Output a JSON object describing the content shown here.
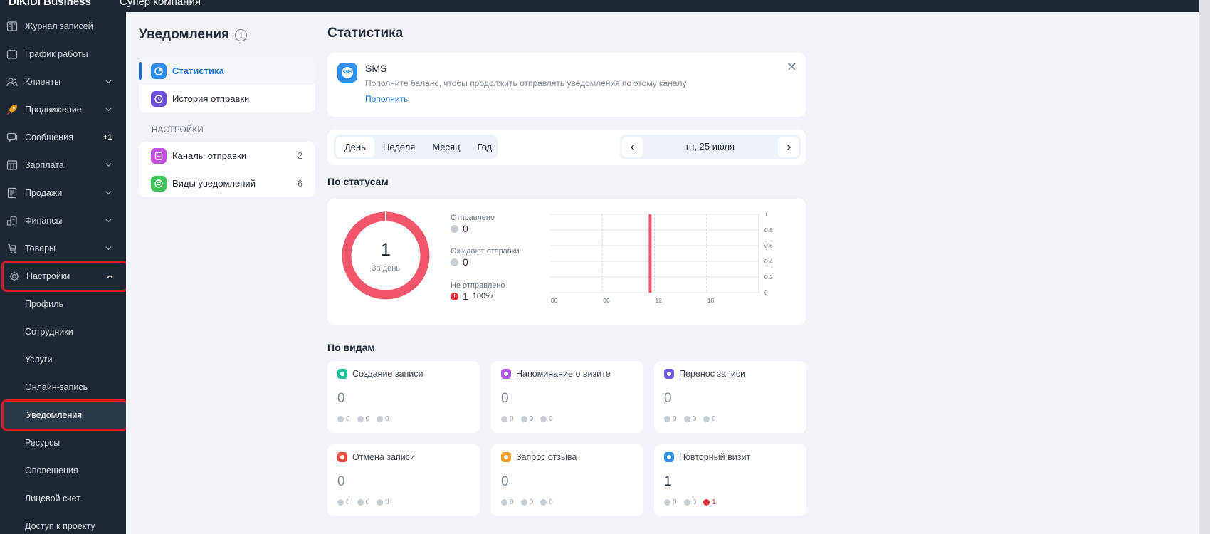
{
  "topbar": {
    "logo": "DIKIDI Business",
    "company": "Супер компания"
  },
  "sidebar": {
    "items": [
      {
        "label": "Журнал записей",
        "icon": "journal-icon",
        "chevron": false,
        "badge": ""
      },
      {
        "label": "График работы",
        "icon": "calendar-icon",
        "chevron": false,
        "badge": ""
      },
      {
        "label": "Клиенты",
        "icon": "clients-icon",
        "chevron": true,
        "badge": ""
      },
      {
        "label": "Продвижение",
        "icon": "rocket-icon",
        "chevron": true,
        "badge": ""
      },
      {
        "label": "Сообщения",
        "icon": "messages-icon",
        "chevron": false,
        "badge": "+1"
      },
      {
        "label": "Зарплата",
        "icon": "salary-icon",
        "chevron": true,
        "badge": ""
      },
      {
        "label": "Продажи",
        "icon": "sales-icon",
        "chevron": true,
        "badge": ""
      },
      {
        "label": "Финансы",
        "icon": "finance-icon",
        "chevron": true,
        "badge": ""
      },
      {
        "label": "Товары",
        "icon": "goods-icon",
        "chevron": true,
        "badge": ""
      },
      {
        "label": "Настройки",
        "icon": "gear-icon",
        "chevron": true,
        "badge": ""
      }
    ],
    "settings_sub": [
      "Профиль",
      "Сотрудники",
      "Услуги",
      "Онлайн-запись",
      "Уведомления",
      "Ресурсы",
      "Оповещения",
      "Лицевой счет",
      "Доступ к проекту"
    ]
  },
  "notifications": {
    "title": "Уведомления",
    "info_glyph": "i",
    "menu": [
      {
        "label": "Статистика",
        "count": ""
      },
      {
        "label": "История отправки",
        "count": ""
      }
    ],
    "settings_label": "НАСТРОЙКИ",
    "settings_menu": [
      {
        "label": "Каналы отправки",
        "count": "2"
      },
      {
        "label": "Виды уведомлений",
        "count": "6"
      }
    ]
  },
  "stats": {
    "title": "Статистика",
    "sms": {
      "logo_text": "SMS",
      "name": "SMS",
      "description": "Пополните баланс, чтобы продолжить отправлять уведомления по этому каналу",
      "link": "Пополнить",
      "close": "✕"
    },
    "period": {
      "options": [
        "День",
        "Неделя",
        "Месяц",
        "Год"
      ],
      "selected": "День",
      "date": "пт, 25 июля",
      "prev": "‹",
      "next": "›"
    },
    "by_status": {
      "title": "По статусам",
      "total": "1",
      "total_label": "За день",
      "sent_label": "Отправлено",
      "sent_value": "0",
      "pending_label": "Ожидают отправки",
      "pending_value": "0",
      "failed_label": "Не отправлено",
      "failed_value": "1",
      "failed_pct": "100%",
      "failed_glyph": "!"
    },
    "by_kind": {
      "title": "По видам",
      "cards": [
        {
          "label": "Создание записи",
          "value": "0",
          "color": "#1fc49a",
          "d1": "0",
          "d2": "0",
          "d3": "0",
          "failed": false
        },
        {
          "label": "Напоминание о визите",
          "value": "0",
          "color": "#b157e6",
          "d1": "0",
          "d2": "0",
          "d3": "0",
          "failed": false
        },
        {
          "label": "Перенос записи",
          "value": "0",
          "color": "#6a5be6",
          "d1": "0",
          "d2": "0",
          "d3": "0",
          "failed": false
        },
        {
          "label": "Отмена записи",
          "value": "0",
          "color": "#ef4a3c",
          "d1": "0",
          "d2": "0",
          "d3": "0",
          "failed": false
        },
        {
          "label": "Запрос отзыва",
          "value": "0",
          "color": "#f59c1d",
          "d1": "0",
          "d2": "0",
          "d3": "0",
          "failed": false
        },
        {
          "label": "Повторный визит",
          "value": "1",
          "color": "#2d8ff0",
          "d1": "0",
          "d2": "0",
          "d3": "1",
          "failed": true
        }
      ]
    }
  },
  "chart_data": {
    "type": "bar",
    "x_ticks": [
      "00",
      "06",
      "12",
      "18"
    ],
    "y_ticks": [
      "0",
      "0.2",
      "0.4",
      "0.6",
      "0.8",
      "1"
    ],
    "ylim": [
      0,
      1
    ],
    "xlim": [
      0,
      24
    ],
    "bar_x": 11.5,
    "values": [
      1
    ],
    "bar_color": "#f2566a",
    "grid": true
  },
  "colors": {
    "accent": "#1a6fd9",
    "failed": "#e8303a",
    "donut": "#f2566a",
    "sidebar": "#1c2833",
    "highlight": "#e0181f"
  }
}
